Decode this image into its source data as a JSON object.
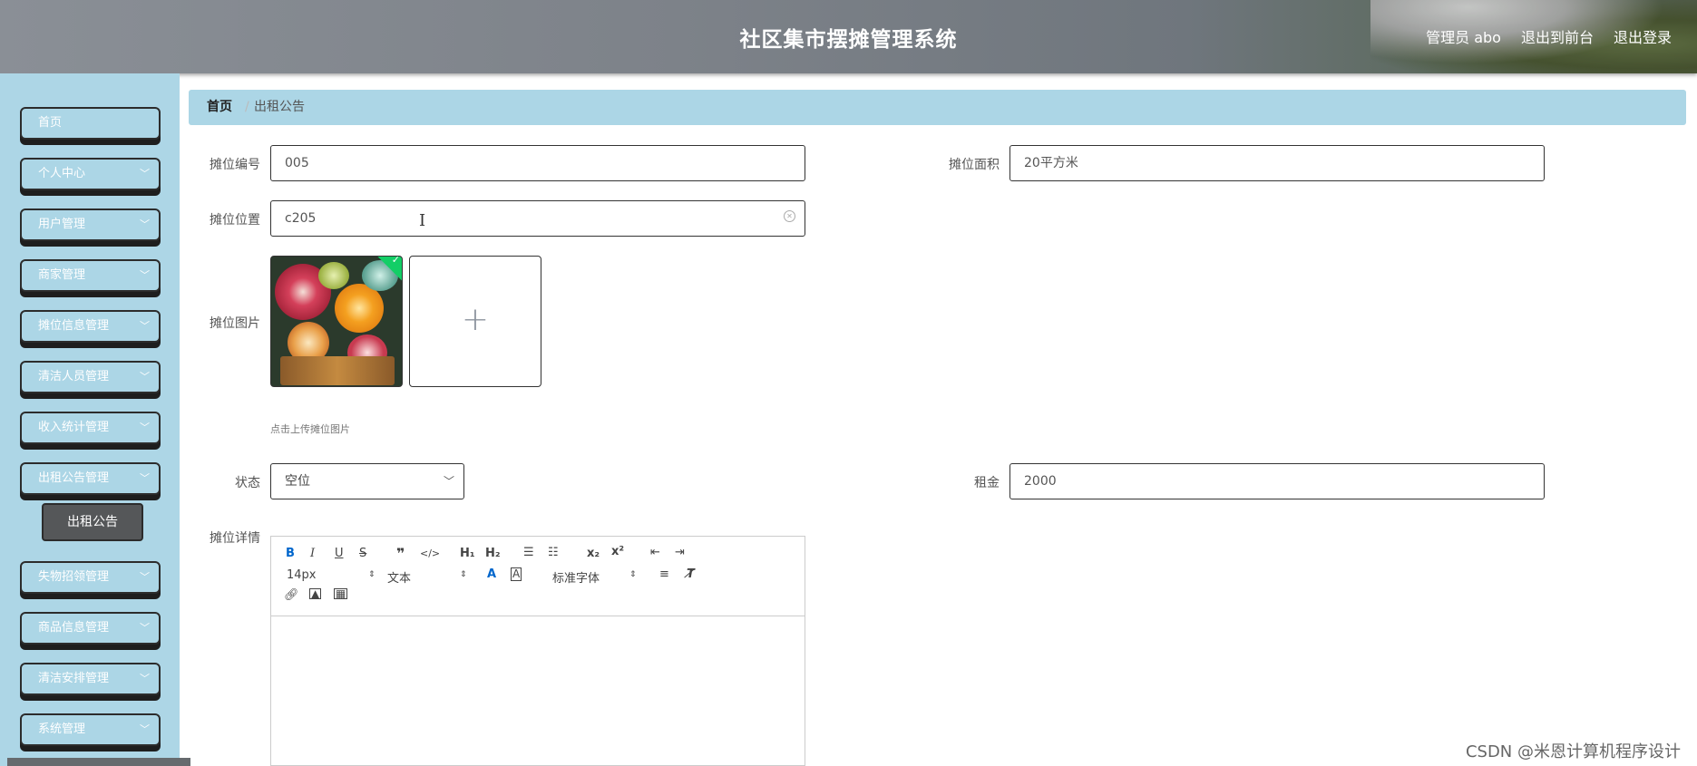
{
  "header": {
    "title": "社区集市摆摊管理系统",
    "user": "管理员 abo",
    "to_front": "退出到前台",
    "logout": "退出登录"
  },
  "sidebar": {
    "items": [
      {
        "label": "首页",
        "expandable": false
      },
      {
        "label": "个人中心",
        "expandable": true
      },
      {
        "label": "用户管理",
        "expandable": true
      },
      {
        "label": "商家管理",
        "expandable": true
      },
      {
        "label": "摊位信息管理",
        "expandable": true
      },
      {
        "label": "清洁人员管理",
        "expandable": true
      },
      {
        "label": "收入统计管理",
        "expandable": true
      },
      {
        "label": "出租公告管理",
        "expandable": true
      },
      {
        "label": "失物招领管理",
        "expandable": true
      },
      {
        "label": "商品信息管理",
        "expandable": true
      },
      {
        "label": "清洁安排管理",
        "expandable": true
      },
      {
        "label": "系统管理",
        "expandable": true
      }
    ],
    "active_sub": "出租公告"
  },
  "breadcrumb": {
    "home": "首页",
    "current": "出租公告"
  },
  "form": {
    "stall_no_label": "摊位编号",
    "stall_no_value": "005",
    "area_label": "摊位面积",
    "area_value": "20平方米",
    "location_label": "摊位位置",
    "location_value": "c205",
    "image_label": "摊位图片",
    "upload_hint": "点击上传摊位图片",
    "upload_plus": "+",
    "status_label": "状态",
    "status_value": "空位",
    "rent_label": "租金",
    "rent_value": "2000",
    "detail_label": "摊位详情"
  },
  "editor": {
    "font_size": "14px",
    "text_type": "文本",
    "font_family": "标准字体"
  },
  "watermark": "CSDN @米恩计算机程序设计"
}
